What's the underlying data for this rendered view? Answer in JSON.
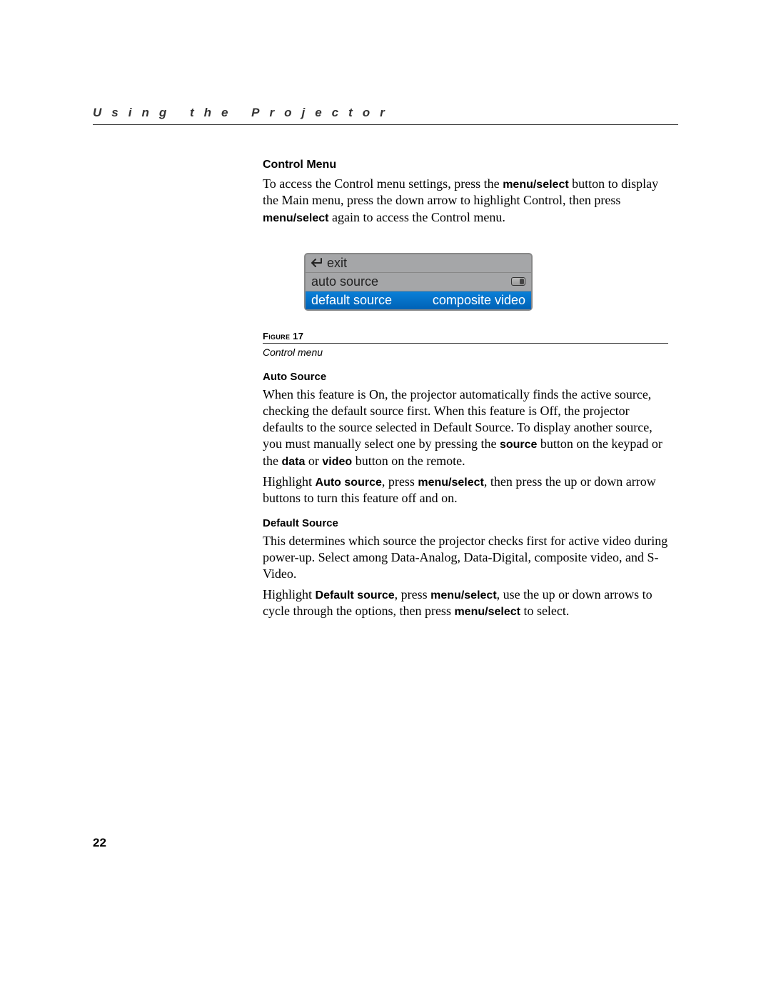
{
  "header": {
    "title": "Using the Projector"
  },
  "section1": {
    "heading": "Control Menu",
    "para_pre": "To access the Control menu settings, press the ",
    "bold1": "menu/select",
    "para_mid": " button to display the Main menu, press the down arrow to highlight Control, then press ",
    "bold2": "menu/select",
    "para_post": " again to access the Control menu."
  },
  "menu": {
    "exit": "exit",
    "auto_source": "auto source",
    "default_source_label": "default source",
    "default_source_value": "composite video"
  },
  "figure": {
    "label_pre": "Figure",
    "label_num": "17",
    "caption": "Control menu"
  },
  "section2": {
    "heading": "Auto Source",
    "p1a": "When this feature is On, the projector automatically finds the active source, checking the default source first. When this feature is Off, the projector defaults to the source selected in Default Source. To display another source, you must manually select one by pressing the ",
    "b1": "source",
    "p1b": " button on the keypad or the ",
    "b2": "data",
    "p1c": " or ",
    "b3": "video",
    "p1d": " button on the remote.",
    "p2a": "Highlight ",
    "b4": "Auto source",
    "p2b": ", press ",
    "b5": "menu/select",
    "p2c": ", then press the up or down arrow buttons to turn this feature off and on."
  },
  "section3": {
    "heading": "Default Source",
    "p1": "This determines which source the projector checks first for active video during power-up. Select among Data-Analog, Data-Digital, composite video, and S-Video.",
    "p2a": "Highlight ",
    "b1": "Default source",
    "p2b": ", press ",
    "b2": "menu/select",
    "p2c": ", use the up or down arrows to cycle through the options, then press ",
    "b3": "menu/select",
    "p2d": " to select."
  },
  "page_number": "22"
}
